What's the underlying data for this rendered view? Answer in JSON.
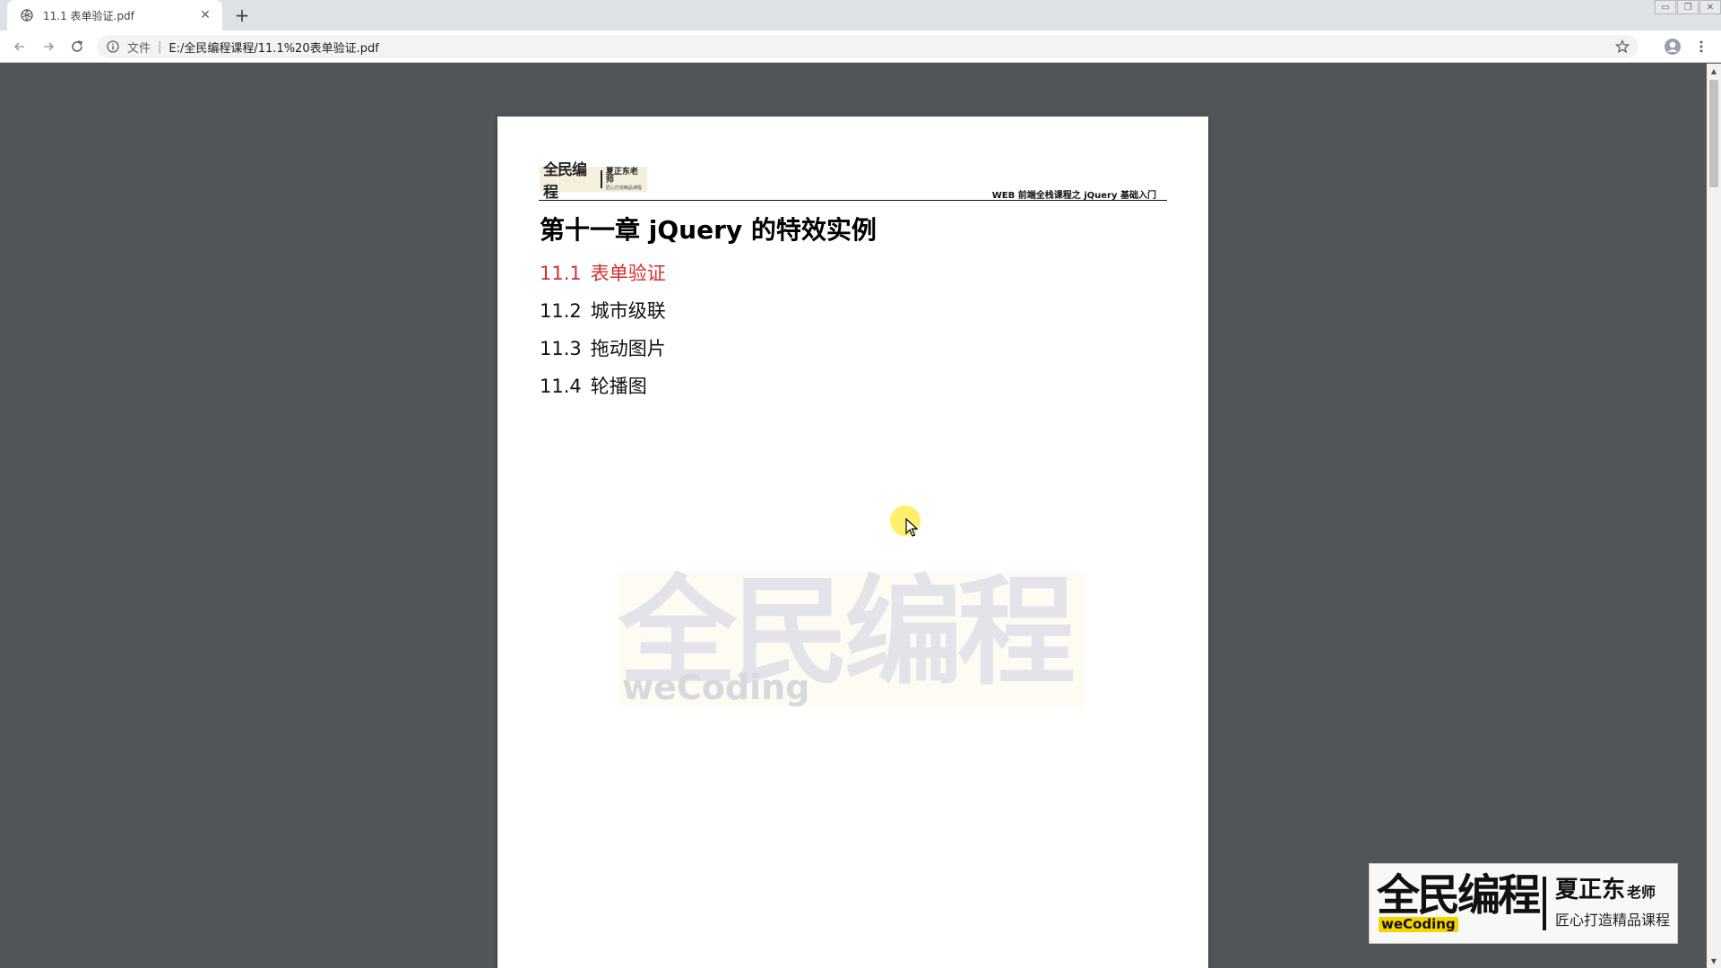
{
  "browser": {
    "tab": {
      "title": "11.1 表单验证.pdf",
      "close_glyph": "✕",
      "favicon": "globe-icon"
    },
    "new_tab_glyph": "+",
    "window_controls": {
      "minimize": "▭",
      "restore": "❐",
      "close": "✕"
    },
    "address_bar": {
      "scheme_label": "文件",
      "separator": "|",
      "url": "E:/全民编程课程/11.1%20表单验证.pdf"
    }
  },
  "document": {
    "logo": {
      "main": "全民编程",
      "name": "夏正东老师",
      "slogan": "匠心打造精品课程"
    },
    "header_right": "WEB 前端全栈课程之 jQuery 基础入门",
    "chapter_title": "第十一章  jQuery 的特效实例",
    "toc": [
      {
        "num": "11.1",
        "label": "表单验证",
        "active": true
      },
      {
        "num": "11.2",
        "label": "城市级联",
        "active": false
      },
      {
        "num": "11.3",
        "label": "拖动图片",
        "active": false
      },
      {
        "num": "11.4",
        "label": "轮播图",
        "active": false
      }
    ],
    "watermark": {
      "main": "全民编程",
      "sub": "weCoding"
    }
  },
  "brand_overlay": {
    "main": "全民编程",
    "sub": "weCoding",
    "name": "夏正东",
    "name_suffix": "老师",
    "slogan": "匠心打造精品课程"
  },
  "colors": {
    "viewer_bg": "#525659",
    "active_toc": "#d32f2f",
    "brand_accent": "#f6d400"
  }
}
